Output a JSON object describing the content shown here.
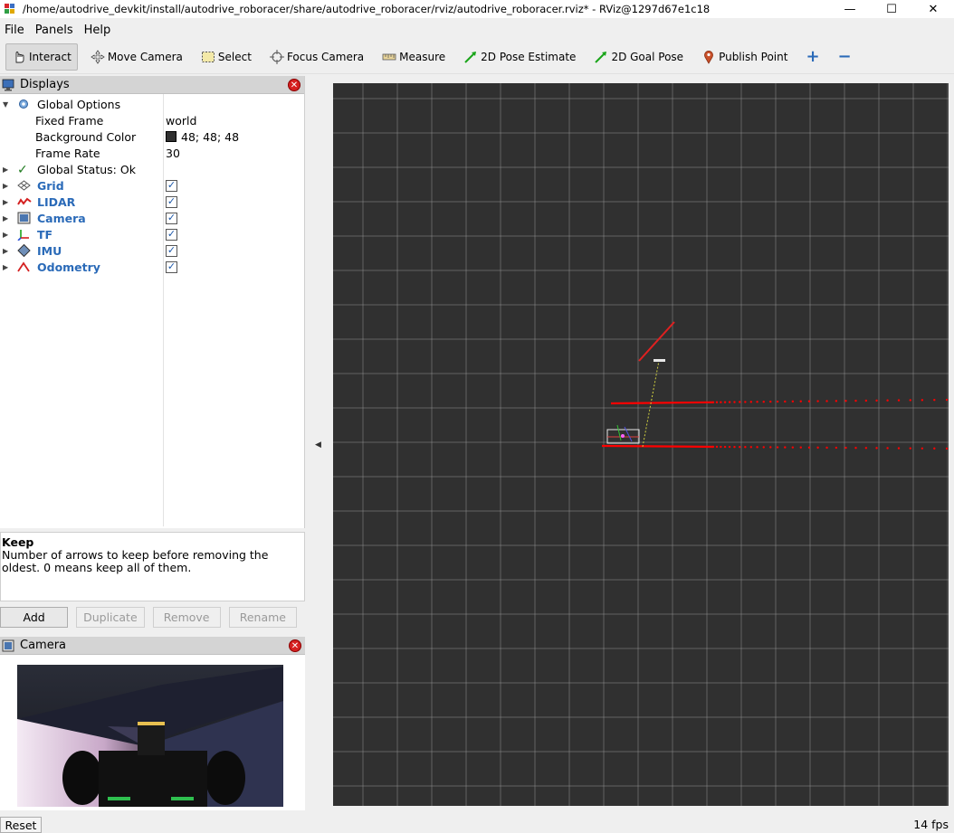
{
  "window": {
    "title": "/home/autodrive_devkit/install/autodrive_roboracer/share/autodrive_roboracer/rviz/autodrive_roboracer.rviz* - RViz@1297d67e1c18",
    "controls": [
      "—",
      "☐",
      "✕"
    ]
  },
  "menu": {
    "file": "File",
    "panels": "Panels",
    "help": "Help"
  },
  "toolbar": {
    "interact": "Interact",
    "move_camera": "Move Camera",
    "select": "Select",
    "focus_camera": "Focus Camera",
    "measure": "Measure",
    "pose_estimate": "2D Pose Estimate",
    "goal_pose": "2D Goal Pose",
    "publish_point": "Publish Point",
    "add_tool": "+",
    "remove_tool": "−"
  },
  "displays": {
    "title": "Displays",
    "global_options": {
      "label": "Global Options",
      "fixed_frame": {
        "label": "Fixed Frame",
        "value": "world"
      },
      "background_color": {
        "label": "Background Color",
        "value": "48; 48; 48",
        "color": "#303030"
      },
      "frame_rate": {
        "label": "Frame Rate",
        "value": "30"
      }
    },
    "global_status": "Global Status: Ok",
    "items": [
      {
        "label": "Grid",
        "checked": "✓",
        "icon": "grid-icon"
      },
      {
        "label": "LIDAR",
        "checked": "✓",
        "icon": "laser-icon"
      },
      {
        "label": "Camera",
        "checked": "✓",
        "icon": "camera-icon"
      },
      {
        "label": "TF",
        "checked": "✓",
        "icon": "axes-icon"
      },
      {
        "label": "IMU",
        "checked": "✓",
        "icon": "diamond-icon"
      },
      {
        "label": "Odometry",
        "checked": "✓",
        "icon": "odometry-icon"
      }
    ]
  },
  "description": {
    "title": "Keep",
    "text": "Number of arrows to keep before removing the oldest. 0 means keep all of them."
  },
  "buttons": {
    "add": "Add",
    "duplicate": "Duplicate",
    "remove": "Remove",
    "rename": "Rename"
  },
  "camera_panel": {
    "title": "Camera"
  },
  "status": {
    "reset": "Reset",
    "fps": "14 fps"
  },
  "colors": {
    "background": "#303030",
    "grid": "#a0a0a0",
    "lidar": "#ff0000",
    "accent": "#2a6ab8"
  }
}
